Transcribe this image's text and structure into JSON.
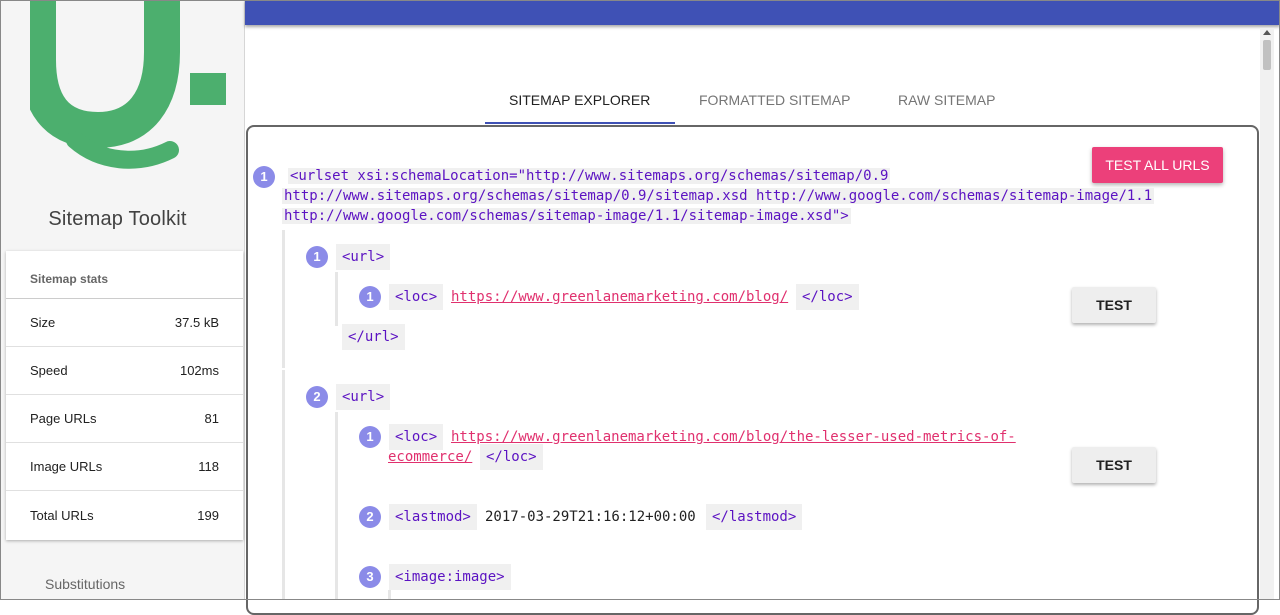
{
  "sidebar": {
    "title": "Sitemap Toolkit",
    "stats_header": "Sitemap stats",
    "stats": [
      {
        "label": "Size",
        "value": "37.5 kB"
      },
      {
        "label": "Speed",
        "value": "102ms"
      },
      {
        "label": "Page URLs",
        "value": "81"
      },
      {
        "label": "Image URLs",
        "value": "118"
      },
      {
        "label": "Total URLs",
        "value": "199"
      }
    ],
    "substitutions_label": "Substitutions",
    "logo_color": "#4caf6e"
  },
  "tabs": [
    {
      "label": "SITEMAP EXPLORER",
      "active": true
    },
    {
      "label": "FORMATTED SITEMAP",
      "active": false
    },
    {
      "label": "RAW SITEMAP",
      "active": false
    }
  ],
  "buttons": {
    "test_all": "TEST ALL URLS",
    "test": "TEST"
  },
  "colors": {
    "topbar": "#3f51b5",
    "accent": "#ec407a",
    "badge": "#8b8be8",
    "tag": "#5b12c2",
    "link": "#e0306e"
  },
  "tree": {
    "root": {
      "num": "1",
      "lines": [
        "<urlset xsi:schemaLocation=\"http://www.sitemaps.org/schemas/sitemap/0.9",
        "http://www.sitemaps.org/schemas/sitemap/0.9/sitemap.xsd http://www.google.com/schemas/sitemap-image/1.1",
        "http://www.google.com/schemas/sitemap-image/1.1/sitemap-image.xsd\">"
      ]
    },
    "urls": [
      {
        "num": "1",
        "open": "<url>",
        "close": "</url>",
        "children": [
          {
            "num": "1",
            "open": "<loc>",
            "link": "https://www.greenlanemarketing.com/blog/",
            "close": "</loc>"
          }
        ]
      },
      {
        "num": "2",
        "open": "<url>",
        "children": [
          {
            "num": "1",
            "open": "<loc>",
            "link_line1": "https://www.greenlanemarketing.com/blog/the-lesser-used-metrics-of-",
            "link_line2": "ecommerce/",
            "close": "</loc>"
          },
          {
            "num": "2",
            "open": "<lastmod>",
            "text": "2017-03-29T21:16:12+00:00",
            "close": "</lastmod>"
          },
          {
            "num": "3",
            "open": "<image:image>"
          }
        ]
      }
    ]
  }
}
